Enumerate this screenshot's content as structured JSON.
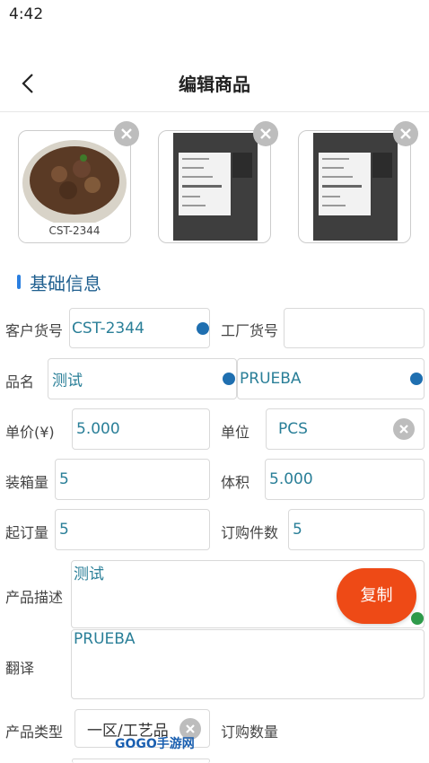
{
  "status_bar": {
    "time": "4:42"
  },
  "header": {
    "title": "编辑商品"
  },
  "images": [
    {
      "caption": "CST-2344"
    },
    {
      "caption": ""
    },
    {
      "caption": ""
    }
  ],
  "section": {
    "title": "基础信息"
  },
  "form": {
    "customer_item_no": {
      "label": "客户货号",
      "value": "CST-2344"
    },
    "factory_item_no": {
      "label": "工厂货号",
      "value": ""
    },
    "product_name": {
      "label": "品名",
      "value": "测试",
      "translation": "PRUEBA"
    },
    "unit_price": {
      "label": "单价(¥)",
      "value": "5.000"
    },
    "unit": {
      "label": "单位",
      "value": "PCS"
    },
    "pack_qty": {
      "label": "装箱量",
      "value": "5"
    },
    "volume": {
      "label": "体积",
      "value": "5.000"
    },
    "moq": {
      "label": "起订量",
      "value": "5"
    },
    "order_pieces": {
      "label": "订购件数",
      "value": "5"
    },
    "description": {
      "label": "产品描述",
      "value": "测试"
    },
    "translation": {
      "label": "翻译",
      "value": "PRUEBA"
    },
    "product_type": {
      "label": "产品类型",
      "value": "一区/工艺品"
    },
    "order_qty": {
      "label": "订购数量"
    }
  },
  "copy_button": {
    "label": "复制"
  },
  "watermark": {
    "text": "GOGO手游网"
  },
  "colors": {
    "accent": "#2a7fe0",
    "copy": "#ee4a16",
    "value_text": "#2a7f98"
  }
}
